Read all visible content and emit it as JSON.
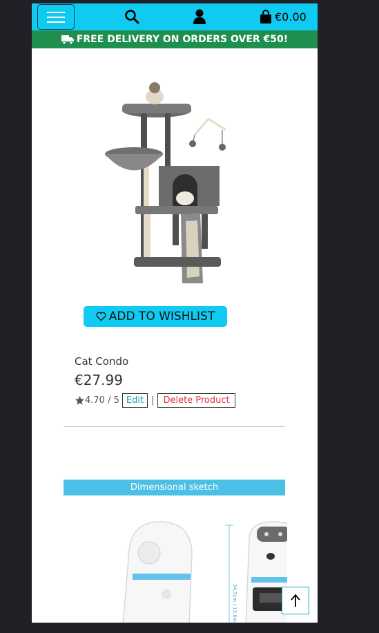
{
  "navbar": {
    "menu_label": "Toggle navigation",
    "cart_total": "€0.00"
  },
  "banner": {
    "text": "FREE DELIVERY ON ORDERS OVER €50!"
  },
  "product": {
    "name": "Cat Condo",
    "price": "€27.99",
    "rating": "4.70 / 5",
    "wishlist_label": "ADD TO WISHLIST",
    "edit_label": "Edit",
    "separator": "|",
    "delete_label": "Delete Product"
  },
  "next_product": {
    "sketch_title": "Dimensional sketch",
    "dimension_label": "34.5cm / 13.6in"
  },
  "colors": {
    "navbar": "#10cbf1",
    "banner": "#1e8f4f",
    "background": "#212027"
  }
}
